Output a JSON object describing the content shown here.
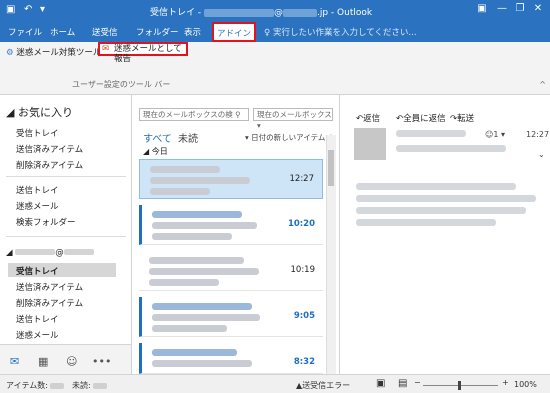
{
  "window": {
    "title_prefix": "受信トレイ - ",
    "title_suffix": "@",
    "title_domain": ".jp - Outlook",
    "minimize": "—",
    "restore": "❐",
    "close": "✕",
    "ribbon_opts": "▣"
  },
  "quick_access": {
    "undo": "↶",
    "dropdown": "▾"
  },
  "tabs": [
    "ファイル",
    "ホーム",
    "送受信",
    "フォルダー",
    "表示",
    "アドイン"
  ],
  "tell_me": "実行したい作業を入力してください...",
  "ribbon": {
    "junk_tools": "迷惑メール対策ツール ▾",
    "report_junk": "迷惑メールとして報告",
    "group_label": "ユーザー設定のツール バー",
    "collapse": "^"
  },
  "sidebar": {
    "favorites_header": "お気に入り",
    "favorites": [
      "受信トレイ",
      "送信済みアイテム",
      "削除済みアイテム"
    ],
    "group2": [
      "送信トレイ",
      "迷惑メール",
      "検索フォルダー"
    ],
    "account_at": "@",
    "account_items": [
      "受信トレイ",
      "送信済みアイテム",
      "削除済みアイテム",
      "送信トレイ",
      "迷惑メール"
    ]
  },
  "nav_icons": [
    "mail-icon",
    "calendar-icon",
    "people-icon",
    "more-icon"
  ],
  "message_list": {
    "search_placeholder": "現在のメールボックスの検",
    "scope": "現在のメールボックス",
    "filter_all": "すべて",
    "filter_unread": "未読",
    "sort": "日付の新しいアイテム ↓",
    "group_today": "今日",
    "messages": [
      {
        "time": "12:27",
        "selected": true,
        "unread": false
      },
      {
        "time": "10:20",
        "selected": false,
        "unread": true
      },
      {
        "time": "10:19",
        "selected": false,
        "unread": false
      },
      {
        "time": "9:05",
        "selected": false,
        "unread": true
      },
      {
        "time": "8:32",
        "selected": false,
        "unread": true
      }
    ]
  },
  "reading_pane": {
    "reply": "返信",
    "reply_all": "全員に返信",
    "forward": "転送",
    "people_count": "1",
    "time": "12:27"
  },
  "statusbar": {
    "items_label": "アイテム数:",
    "unread_label": "未読:",
    "error": "送受信エラー",
    "zoom": "100%"
  }
}
